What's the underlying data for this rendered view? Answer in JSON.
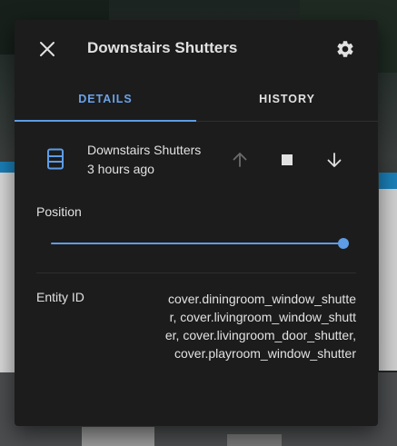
{
  "dialog": {
    "title": "Downstairs Shutters",
    "close_icon": "close-icon",
    "settings_icon": "gear-icon"
  },
  "tabs": [
    {
      "label": "DETAILS",
      "active": true
    },
    {
      "label": "HISTORY",
      "active": false
    }
  ],
  "entity": {
    "icon": "window-shutter-icon",
    "name": "Downstairs Shutters",
    "last_changed": "3 hours ago",
    "controls": [
      "arrow-up-icon",
      "stop-icon",
      "arrow-down-icon"
    ]
  },
  "position": {
    "label": "Position",
    "value": 100
  },
  "attributes": [
    {
      "label": "Entity ID",
      "value": "cover.diningroom_window_shutter, cover.livingroom_window_shutter, cover.livingroom_door_shutter, cover.playroom_window_shutter"
    }
  ],
  "colors": {
    "accent": "#5d9ce6",
    "dialog_bg": "#1c1c1c",
    "text": "#e1e1e1"
  }
}
